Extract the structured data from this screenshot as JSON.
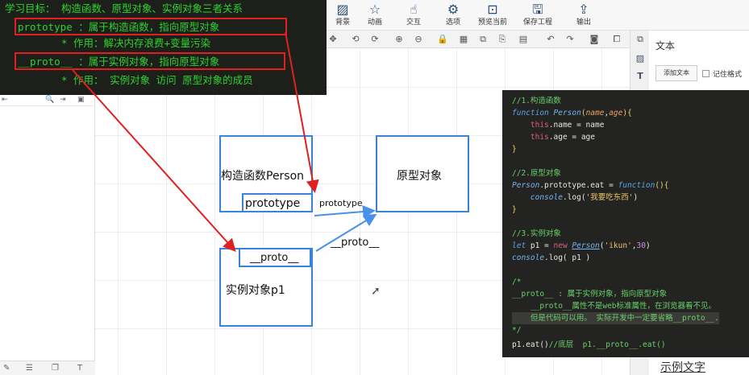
{
  "ribbon": {
    "items": [
      {
        "label": "背景",
        "icon": "background-icon"
      },
      {
        "label": "动画",
        "icon": "animation-star-icon"
      },
      {
        "label": "交互",
        "icon": "interaction-pointer-icon"
      },
      {
        "label": "选项",
        "icon": "settings-gear-icon"
      },
      {
        "label": "预览当前",
        "icon": "preview-icon"
      },
      {
        "label": "保存工程",
        "icon": "save-icon"
      },
      {
        "label": "输出",
        "icon": "export-icon"
      }
    ]
  },
  "notes": {
    "line1": "学习目标： 构造函数、原型对象、实例对象三者关系",
    "line2": " prototype ：属于构造函数，指向原型对象",
    "line3": "* 作用：解决内存浪费+变量污染",
    "line4": " __proto__ ：属于实例对象，指向原型对象",
    "line5": "* 作用： 实例对象 访问 原型对象的成员"
  },
  "diagram": {
    "constructor_label": "构造函数Person",
    "prototype_field": "prototype",
    "prototype_object_label": "原型对象",
    "proto_field": "__proto__",
    "instance_label": "实例对象p1",
    "arrow_prototype_label": "prototype",
    "arrow_proto_label": "__proto__"
  },
  "code": {
    "c1": "//1.构造函数",
    "c2_kw": "function",
    "c2_fn": "Person",
    "c2_p1": "name",
    "c2_p2": "age",
    "c3_this": "this",
    "c3_rest": ".name = name",
    "c4_this": "this",
    "c4_rest": ".age = age",
    "c5": "}",
    "c6": "//2.原型对象",
    "c7_obj": "Person",
    "c7_mid": ".prototype.eat = ",
    "c7_kw": "function",
    "c7_end": "(){",
    "c8_con": "console",
    "c8_mid": ".log(",
    "c8_str": "'我要吃东西'",
    "c8_end": ")",
    "c9": "}",
    "c10": "//3.实例对象",
    "c11_let": "let",
    "c11_mid": " p1 = ",
    "c11_new": "new",
    "c11_cls": "Person",
    "c11_str": "'ikun'",
    "c11_num": "30",
    "c12_con": "console",
    "c12_rest": ".log( p1 )",
    "c13": "/*",
    "c14": "__proto__ : 属于实例对象，指向原型对象",
    "c15": "    __proto__属性不是web标准属性，在浏览器看不见。",
    "c16": "    但是代码可以用。 实际开发中一定要省略__proto__.",
    "c17": "*/",
    "c18_a": "p1.eat()",
    "c18_b": "//底层  p1.__proto__.eat()"
  },
  "right_panel": {
    "title": "文本",
    "add_text_button": "添加文本",
    "remember_format": "记住格式",
    "sample_text": "示例文字"
  },
  "colors": {
    "note_text": "#2fd12f",
    "highlight_red": "#e02020",
    "diagram_blue": "#3a82e0",
    "code_bg": "#232421"
  }
}
